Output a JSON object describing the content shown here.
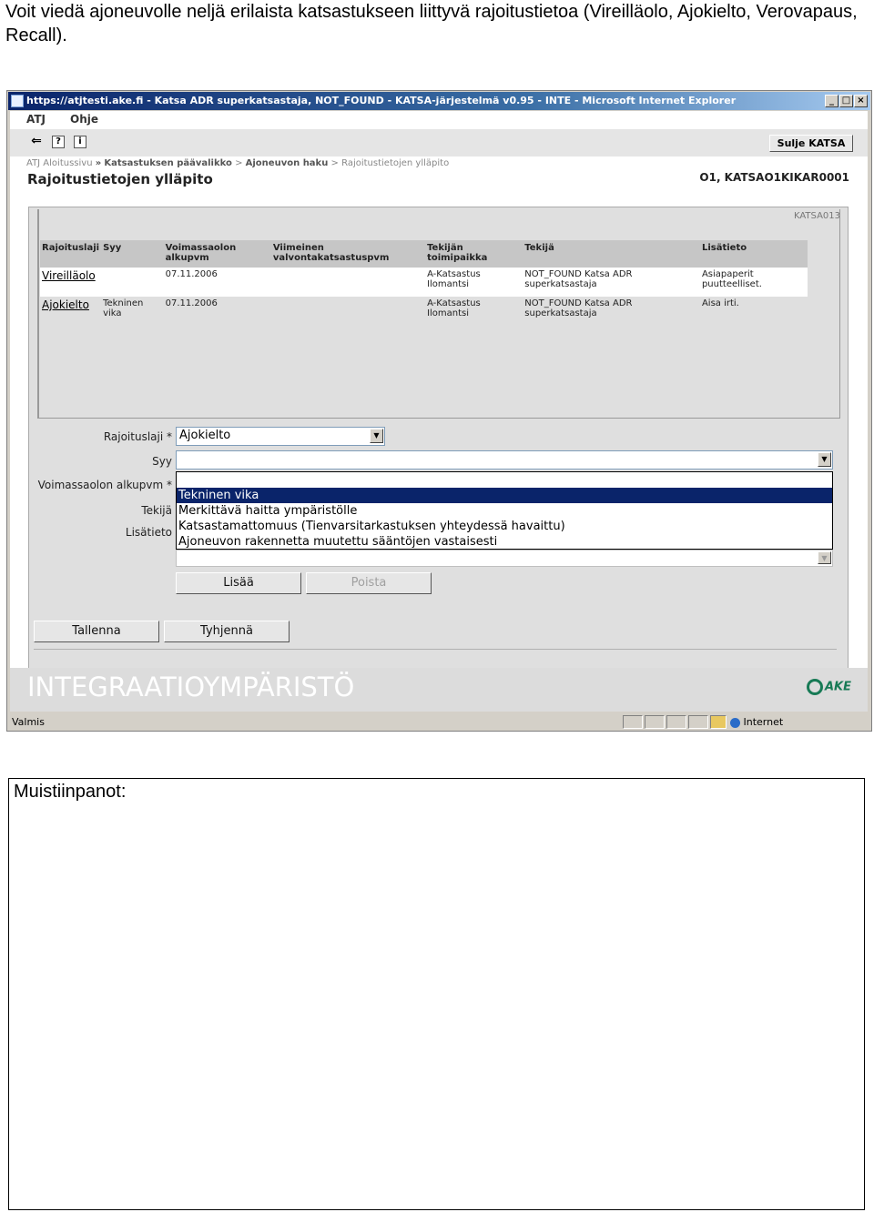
{
  "intro_text": "Voit viedä ajoneuvolle neljä erilaista katsastukseen liittyvä rajoitustietoa (Vireilläolo, Ajokielto, Verovapaus, Recall).",
  "window": {
    "title": "https://atjtesti.ake.fi - Katsa ADR superkatsastaja, NOT_FOUND - KATSA-järjestelmä v0.95 - INTE - Microsoft Internet Explorer",
    "buttons": [
      "_",
      "□",
      "×"
    ]
  },
  "app_menu": [
    "ATJ",
    "Ohje"
  ],
  "toolbar": {
    "icons": [
      "back-arrow-icon",
      "help-icon",
      "info-icon"
    ],
    "close_label": "Sulje KATSA"
  },
  "breadcrumb": {
    "items": [
      "ATJ Aloitussivu",
      "Katsastuksen päävalikko",
      "Ajoneuvon haku",
      "Rajoitustietojen ylläpito"
    ],
    "separators": [
      "»",
      ">",
      ">"
    ]
  },
  "page": {
    "title": "Rajoitustietojen ylläpito",
    "user_info": "O1, KATSAO1KIKAR0001",
    "screen_code": "KATSA013"
  },
  "table": {
    "headers": [
      "Rajoituslaji",
      "Syy",
      "Voimassaolon alkupvm",
      "Viimeinen valvontakatsastuspvm",
      "Tekijän toimipaikka",
      "Tekijä",
      "Lisätieto"
    ],
    "rows": [
      {
        "laji": "Vireilläolo",
        "syy": "",
        "alkupvm": "07.11.2006",
        "viimeinen": "",
        "toimipaikka": "A-Katsastus Ilomantsi",
        "tekija": "NOT_FOUND Katsa ADR superkatsastaja",
        "lisatieto": "Asiapaperit puutteelliset."
      },
      {
        "laji": "Ajokielto",
        "syy": "Tekninen vika",
        "alkupvm": "07.11.2006",
        "viimeinen": "",
        "toimipaikka": "A-Katsastus Ilomantsi",
        "tekija": "NOT_FOUND Katsa ADR superkatsastaja",
        "lisatieto": "Aisa irti."
      }
    ]
  },
  "form": {
    "labels": {
      "rajoituslaji": "Rajoituslaji *",
      "syy": "Syy",
      "alkupvm": "Voimassaolon alkupvm *",
      "tekija": "Tekijä",
      "lisatieto": "Lisätieto"
    },
    "rajoituslaji_value": "Ajokielto",
    "syy_value": "",
    "syy_options": [
      "Tekninen vika",
      "Merkittävä haitta ympäristölle",
      "Katsastamattomuus (Tienvarsitarkastuksen yhteydessä havaittu)",
      "Ajoneuvon rakennetta muutettu sääntöjen vastaisesti"
    ],
    "selected_option_index": 0,
    "add_label": "Lisää",
    "remove_label": "Poista"
  },
  "actions": {
    "save_label": "Tallenna",
    "clear_label": "Tyhjennä"
  },
  "footer": {
    "environment": "INTEGRAATIOYMPÄRISTÖ",
    "logo_text": "AKE"
  },
  "statusbar": {
    "status": "Valmis",
    "zone": "Internet"
  },
  "notes": {
    "label": "Muistiinpanot:"
  }
}
